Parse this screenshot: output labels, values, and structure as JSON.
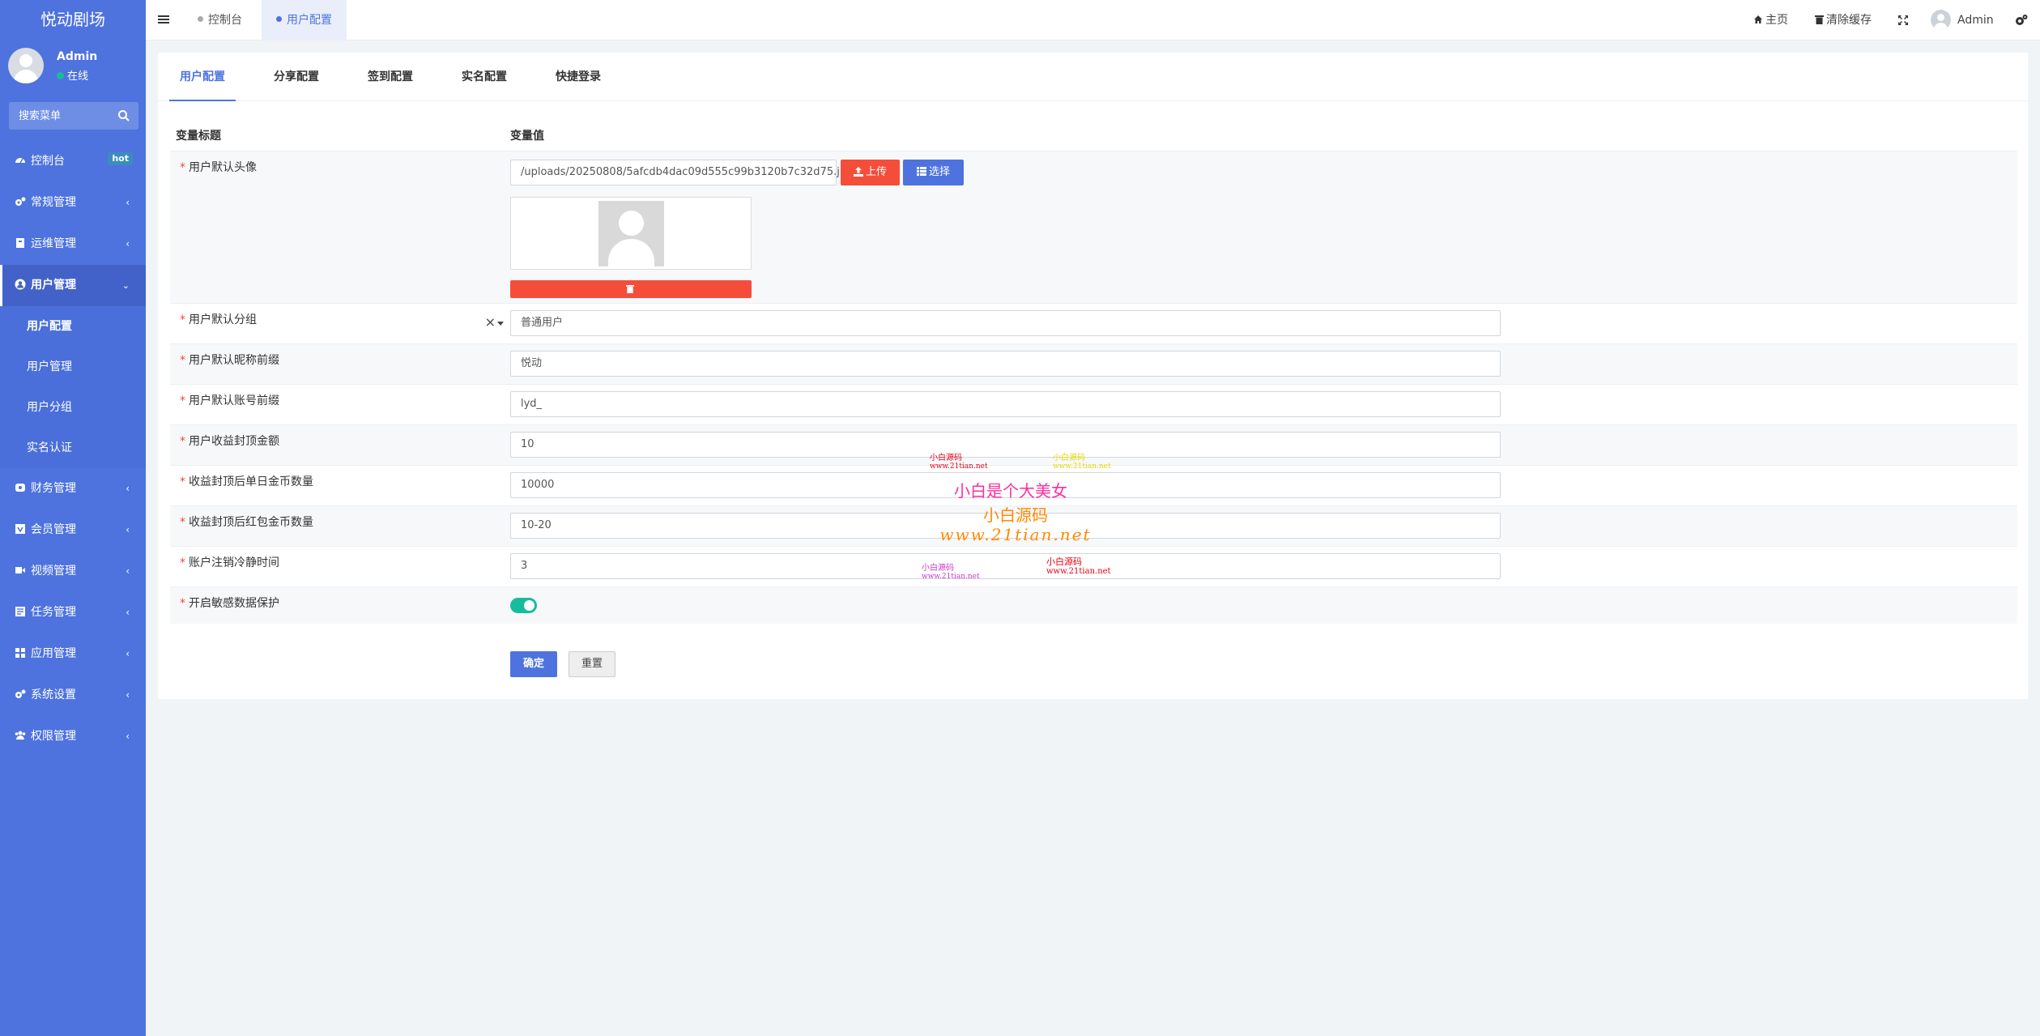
{
  "app": {
    "logo": "悦动剧场"
  },
  "user": {
    "name": "Admin",
    "status": "在线"
  },
  "sidebar": {
    "search_placeholder": "搜索菜单",
    "items": [
      {
        "label": "控制台",
        "icon": "dashboard-icon",
        "badge": "hot"
      },
      {
        "label": "常规管理",
        "icon": "cogs-icon"
      },
      {
        "label": "运维管理",
        "icon": "server-icon"
      },
      {
        "label": "用户管理",
        "icon": "user-circle-icon",
        "expanded": true
      },
      {
        "label": "财务管理",
        "icon": "money-icon"
      },
      {
        "label": "会员管理",
        "icon": "vip-icon"
      },
      {
        "label": "视频管理",
        "icon": "video-icon"
      },
      {
        "label": "任务管理",
        "icon": "tasks-icon"
      },
      {
        "label": "应用管理",
        "icon": "apps-icon"
      },
      {
        "label": "系统设置",
        "icon": "cogs-icon"
      },
      {
        "label": "权限管理",
        "icon": "group-icon"
      }
    ],
    "submenu": [
      "用户配置",
      "用户管理",
      "用户分组",
      "实名认证"
    ]
  },
  "topbar": {
    "tabs": [
      "控制台",
      "用户配置"
    ],
    "home": "主页",
    "clear_cache": "清除缓存",
    "admin": "Admin"
  },
  "config_tabs": [
    "用户配置",
    "分享配置",
    "签到配置",
    "实名配置",
    "快捷登录"
  ],
  "table": {
    "col_title": "变量标题",
    "col_value": "变量值",
    "avatar_label": "用户默认头像",
    "avatar_path": "/uploads/20250808/5afcdb4dac09d555c99b3120b7c32d75.jpg",
    "upload_btn": "上传",
    "choose_btn": "选择",
    "group_label": "用户默认分组",
    "group_value": "普通用户",
    "nickname_prefix_label": "用户默认昵称前缀",
    "nickname_prefix_value": "悦动",
    "account_prefix_label": "用户默认账号前缀",
    "account_prefix_value": "lyd_",
    "income_cap_label": "用户收益封顶金额",
    "income_cap_value": "10",
    "daily_coins_label": "收益封顶后单日金币数量",
    "daily_coins_value": "10000",
    "redpack_coins_label": "收益封顶后红包金币数量",
    "redpack_coins_value": "10-20",
    "cooling_label": "账户注销冷静时间",
    "cooling_value": "3",
    "sensitive_label": "开启敏感数据保护",
    "sensitive_on": true
  },
  "actions": {
    "confirm": "确定",
    "reset": "重置"
  },
  "watermarks": {
    "a1": "小白源码",
    "a2": "www.21tian.net",
    "b1": "小白源码",
    "b2": "www.21tian.net",
    "main": "小白是个大美女",
    "big1": "小白源码",
    "big2": "www.21tian.net",
    "c1": "小白源码",
    "c2": "www.21tian.net",
    "d1": "小白源码",
    "d2": "www.21tian.net"
  },
  "colors": {
    "sidebar": "#4e73df",
    "primary": "#4e73df",
    "danger": "#f44e3b",
    "success": "#18bc9c"
  }
}
